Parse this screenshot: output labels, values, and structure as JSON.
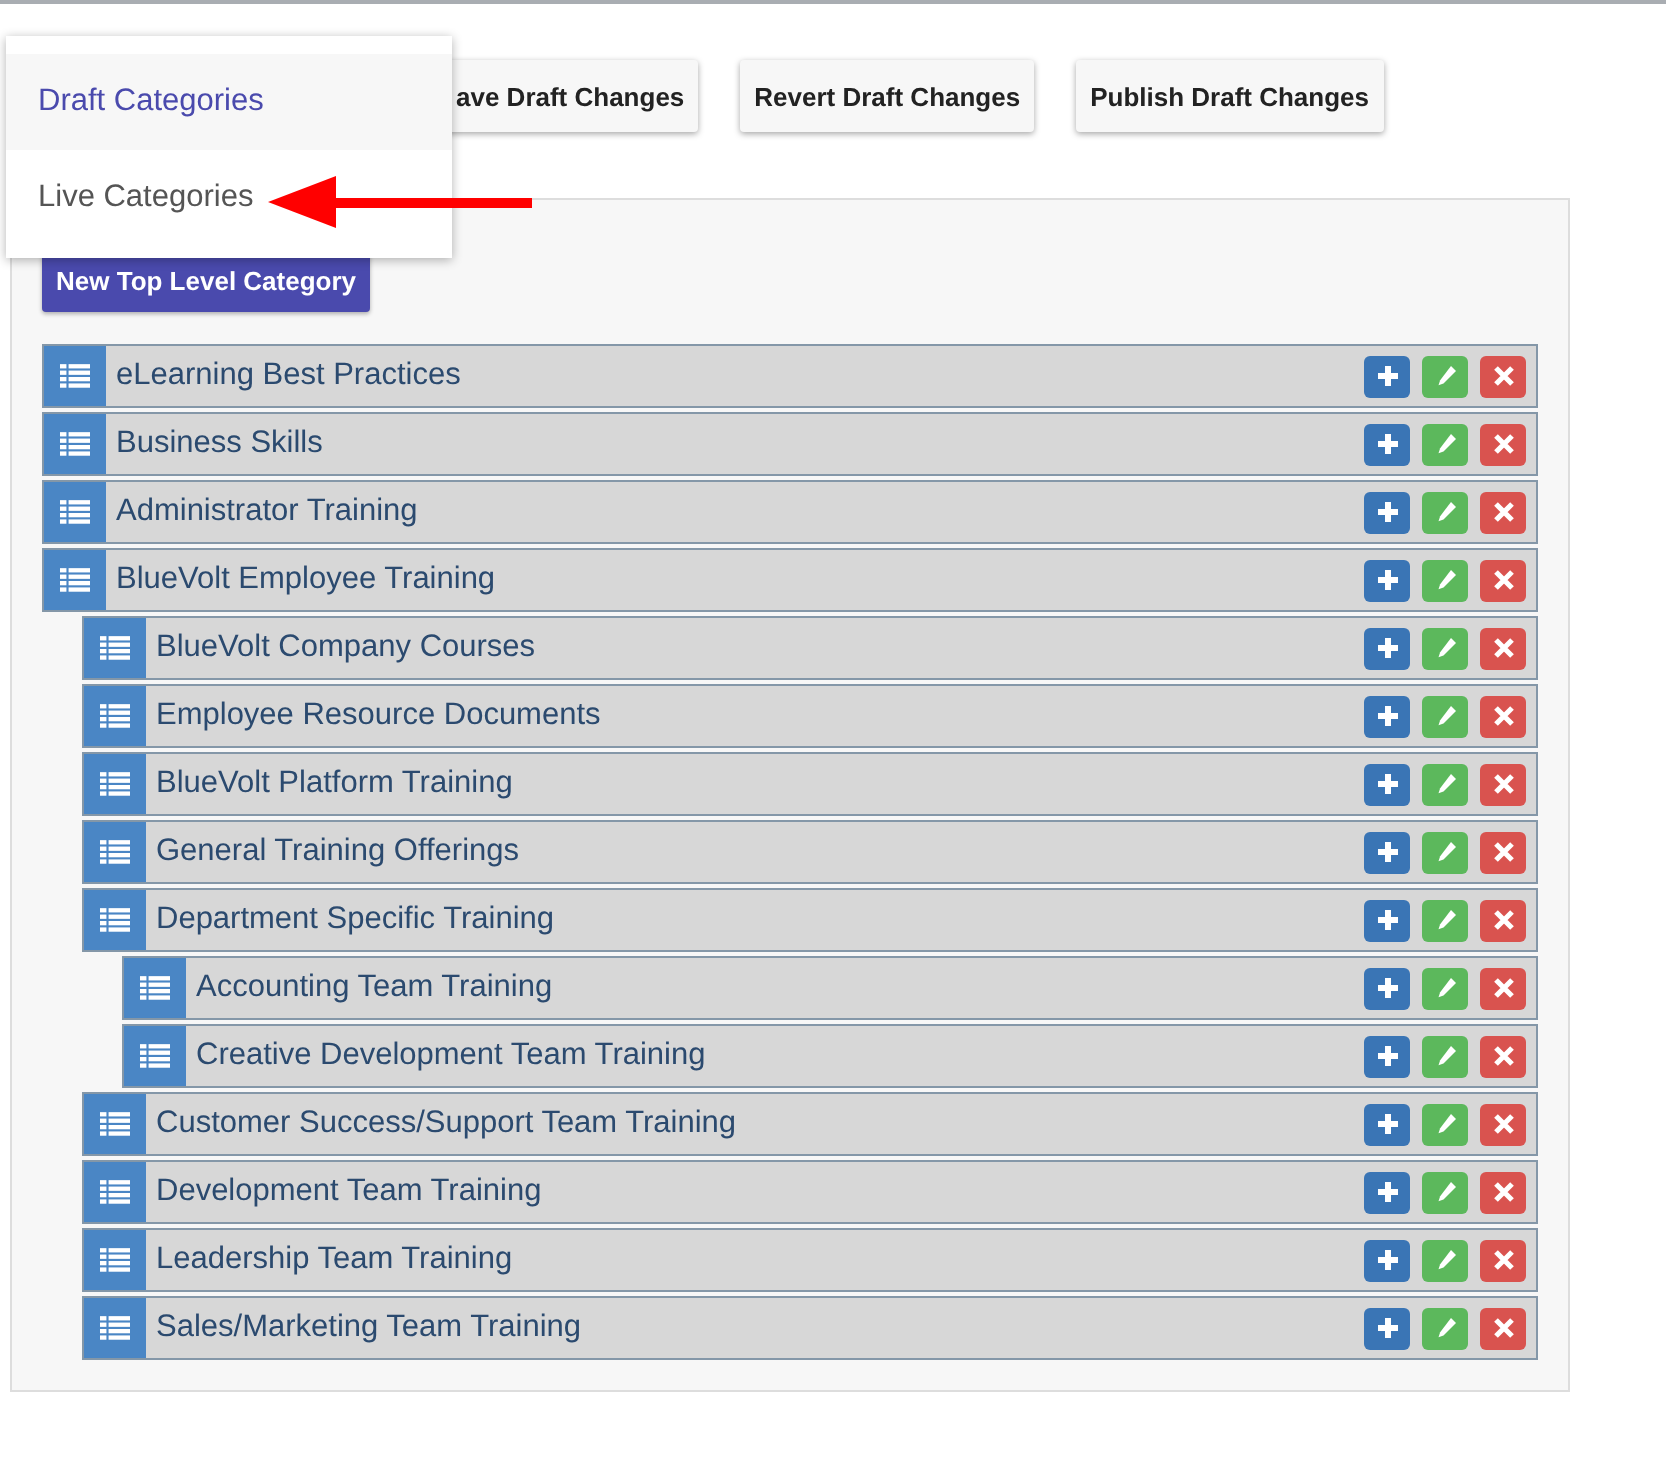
{
  "dropdown": {
    "items": [
      {
        "label": "Draft Categories",
        "selected": true
      },
      {
        "label": "Live Categories",
        "selected": false
      }
    ]
  },
  "toolbar": {
    "buttons": [
      "ave Draft Changes",
      "Revert Draft Changes",
      "Publish Draft Changes"
    ]
  },
  "panel": {
    "new_button": "New Top Level Category",
    "categories": [
      {
        "name": "eLearning Best Practices"
      },
      {
        "name": "Business Skills"
      },
      {
        "name": "Administrator Training"
      },
      {
        "name": "BlueVolt Employee Training",
        "children": [
          {
            "name": "BlueVolt Company Courses"
          },
          {
            "name": "Employee Resource Documents"
          },
          {
            "name": "BlueVolt Platform Training"
          },
          {
            "name": "General Training Offerings"
          },
          {
            "name": "Department Specific Training",
            "children": [
              {
                "name": "Accounting Team Training"
              },
              {
                "name": "Creative Development Team Training"
              }
            ]
          },
          {
            "name": "Customer Success/Support Team Training"
          },
          {
            "name": "Development Team Training"
          },
          {
            "name": "Leadership Team Training"
          },
          {
            "name": "Sales/Marketing Team Training"
          }
        ]
      }
    ]
  }
}
